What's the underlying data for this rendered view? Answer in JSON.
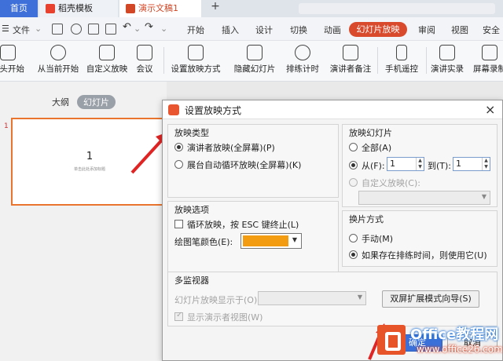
{
  "tabs": {
    "home": "首页",
    "template": "稻壳模板",
    "doc": "演示文稿1",
    "close": "×",
    "new": "+"
  },
  "menu": {
    "file": "文件",
    "items": [
      "开始",
      "插入",
      "设计",
      "切换",
      "动画",
      "幻灯片放映",
      "审阅",
      "视图",
      "安全"
    ]
  },
  "ribbon": {
    "items": [
      "从头开始",
      "从当前开始",
      "自定义放映",
      "会议",
      "设置放映方式",
      "隐藏幻灯片",
      "排练计时",
      "演讲者备注",
      "手机遥控",
      "演讲实录",
      "屏幕录制"
    ]
  },
  "left_panel": {
    "outline_tab": "大纲",
    "slides_tab": "幻灯片",
    "slide_number": "1",
    "thumb_number": "1",
    "thumb_hint": "单击此处添加标题"
  },
  "dialog": {
    "title": "设置放映方式",
    "show_type": {
      "label": "放映类型",
      "opt_speaker": "演讲者放映(全屏幕)(P)",
      "opt_kiosk": "展台自动循环放映(全屏幕)(K)"
    },
    "show_slides": {
      "label": "放映幻灯片",
      "opt_all": "全部(A)",
      "opt_from": "从(F):",
      "from_value": "1",
      "to_label": "到(T):",
      "to_value": "1",
      "opt_custom": "自定义放映(C):"
    },
    "show_options": {
      "label": "放映选项",
      "loop": "循环放映，按 ESC 键终止(L)",
      "pen_color_label": "绘图笔颜色(E):",
      "pen_color": "#f39c12"
    },
    "advance": {
      "label": "换片方式",
      "manual": "手动(M)",
      "timings": "如果存在排练时间，则使用它(U)"
    },
    "multi_monitor": {
      "label": "多监视器",
      "display_on": "幻灯片放映显示于(O):",
      "dual_wizard": "双屏扩展模式向导(S)",
      "presenter_view": "显示演示者视图(W)"
    },
    "ok": "确定",
    "cancel": "取消"
  },
  "watermark": {
    "line1": "Office教程网",
    "line2": "www.office26.com"
  },
  "colors": {
    "accent": "#d94a2c",
    "highlight_border": "#e8742e",
    "primary_button": "#3a70d8"
  }
}
